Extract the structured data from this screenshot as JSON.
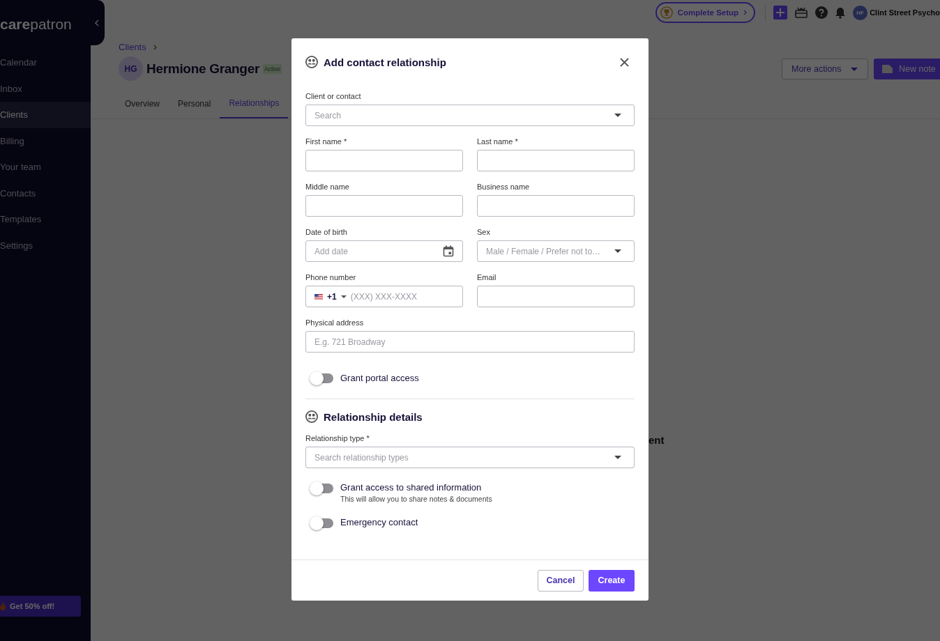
{
  "sidebar": {
    "logo_bold": "care",
    "logo_light": "patron",
    "items": [
      {
        "label": "Calendar",
        "selected": false
      },
      {
        "label": "Inbox",
        "selected": false
      },
      {
        "label": "Clients",
        "selected": true
      },
      {
        "label": "Billing",
        "selected": false
      },
      {
        "label": "Your team",
        "selected": false
      },
      {
        "label": "Contacts",
        "selected": false
      },
      {
        "label": "Templates",
        "selected": false
      },
      {
        "label": "Settings",
        "selected": false
      }
    ],
    "promo": "Get 50% off!"
  },
  "topbar": {
    "setup": "Complete Setup",
    "avatar": "HF",
    "account": "Clint Street Psycho"
  },
  "client": {
    "breadcrumb": "Clients",
    "initials": "HG",
    "name": "Hermione Granger",
    "status": "Active",
    "more_actions": "More actions",
    "new_note": "New note",
    "tabs": [
      {
        "label": "Overview",
        "selected": false
      },
      {
        "label": "Personal",
        "selected": false
      },
      {
        "label": "Relationships",
        "selected": true
      }
    ],
    "empty_text": "ent"
  },
  "dialog": {
    "title": "Add contact relationship",
    "fields": [
      {
        "kind": "select",
        "label": "Client or contact",
        "placeholder": "Search",
        "wide": true
      },
      {
        "kind": "text",
        "label": "First name *",
        "wide": false
      },
      {
        "kind": "text",
        "label": "Last name *",
        "wide": false
      },
      {
        "kind": "text",
        "label": "Middle name",
        "wide": false
      },
      {
        "kind": "text",
        "label": "Business name",
        "wide": false
      },
      {
        "kind": "date",
        "label": "Date of birth",
        "placeholder": "Add date",
        "wide": false
      },
      {
        "kind": "select",
        "label": "Sex",
        "placeholder": "Male / Female / Prefer not to…",
        "wide": false
      },
      {
        "kind": "phone",
        "label": "Phone number",
        "code": "+1",
        "placeholder": "(XXX) XXX-XXXX",
        "wide": false
      },
      {
        "kind": "text",
        "label": "Email",
        "wide": false
      },
      {
        "kind": "text",
        "label": "Physical address",
        "placeholder": "E.g. 721 Broadway",
        "wide": true
      }
    ],
    "portal_toggle": {
      "label": "Grant portal access",
      "on": false
    },
    "section_title": "Relationship details",
    "relationship_field": {
      "kind": "select",
      "label": "Relationship type *",
      "placeholder": "Search relationship types",
      "wide": true
    },
    "toggles": [
      {
        "label": "Grant access to shared information",
        "description": "This will allow you to share notes & documents",
        "on": false
      },
      {
        "label": "Emergency contact",
        "on": false
      }
    ],
    "cancel": "Cancel",
    "create": "Create"
  }
}
